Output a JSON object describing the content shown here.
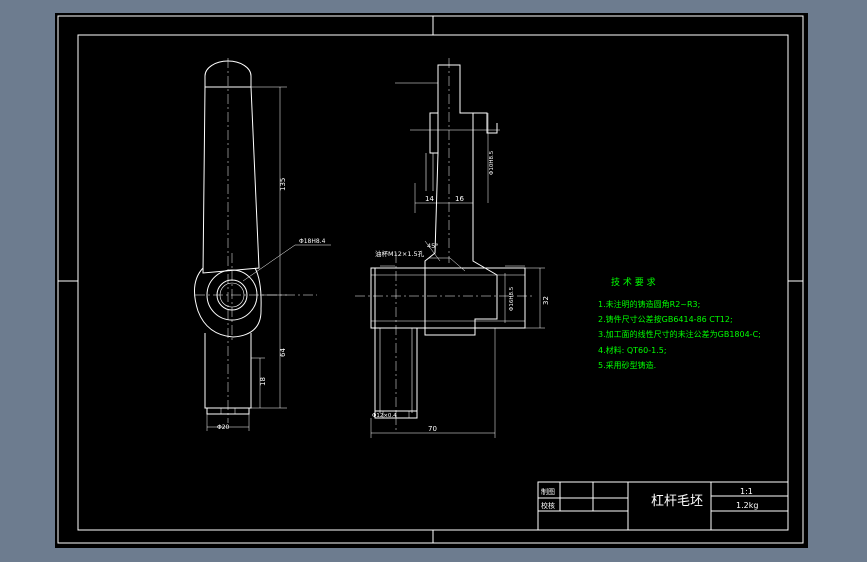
{
  "colors": {
    "background": "#6d7c8f",
    "viewport": "#000000",
    "lines": "#ffffff",
    "notes": "#00ff00"
  },
  "drawing": {
    "dimensions": {
      "length_main": "135",
      "length_lower": "64",
      "length_small": "18",
      "bore_note": "Φ18H8.4",
      "bottom_dia": "Φ20",
      "thread_note": "油杯M12×1.5孔",
      "angle": "45°",
      "dim_14": "14",
      "dim_16": "16",
      "width_70": "70",
      "height_32": "32",
      "bore_right": "Φ16H8.5",
      "bottom_right": "Φ12×0.4",
      "vertical_right": "Φ10H8.5"
    },
    "notes": {
      "title": "技 术 要 求",
      "items": [
        "1.未注明的铸造圆角R2~R3;",
        "2.铸件尺寸公差按GB6414-86  CT12;",
        "3.加工面的线性尺寸的未注公差为GB1804-C;",
        "4.材料: QT60-1.5;",
        "5.采用砂型铸造."
      ]
    },
    "title_block": {
      "label_drawn": "制图",
      "label_checked": "校核",
      "part_name": "杠杆毛坯",
      "scale": "1:1",
      "weight": "1.2kg"
    }
  }
}
